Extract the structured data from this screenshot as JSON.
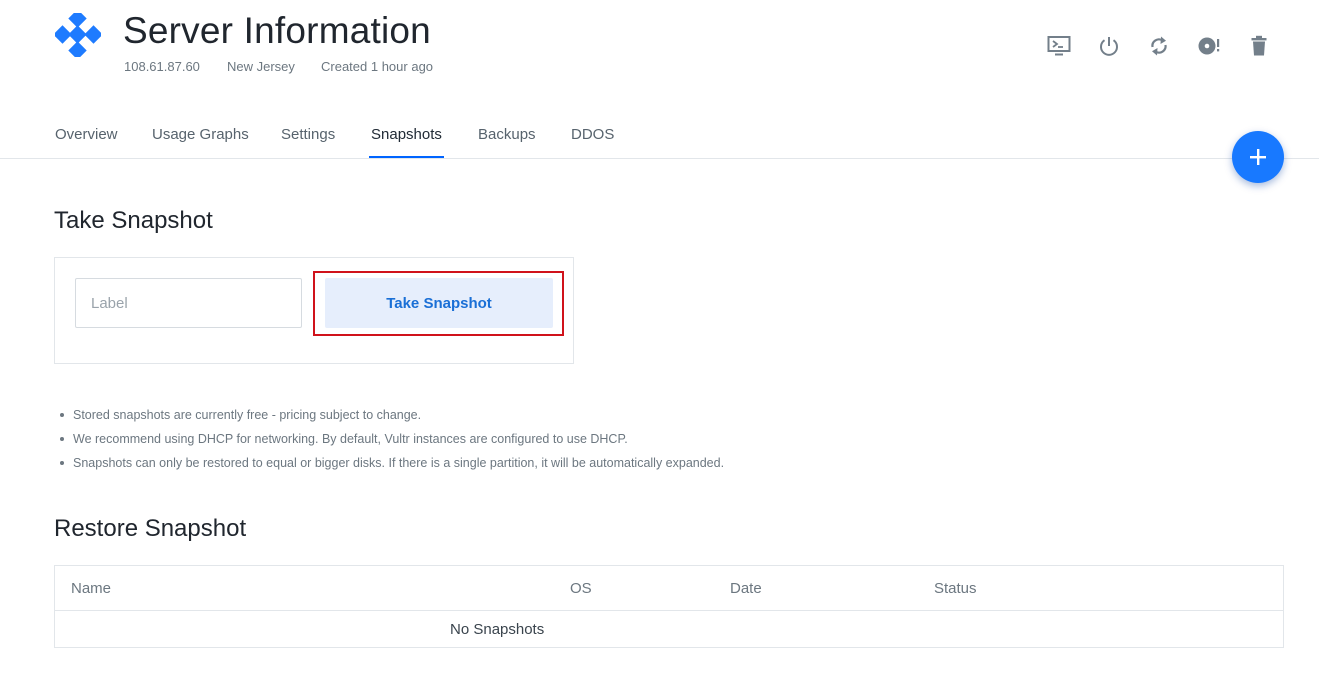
{
  "header": {
    "title": "Server Information",
    "ip": "108.61.87.60",
    "location": "New Jersey",
    "created": "Created 1 hour ago",
    "actions": [
      {
        "name": "console-icon"
      },
      {
        "name": "power-icon"
      },
      {
        "name": "restart-icon"
      },
      {
        "name": "iso-disc-icon"
      },
      {
        "name": "trash-icon"
      }
    ]
  },
  "tabs": [
    {
      "label": "Overview",
      "active": false
    },
    {
      "label": "Usage Graphs",
      "active": false
    },
    {
      "label": "Settings",
      "active": false
    },
    {
      "label": "Snapshots",
      "active": true
    },
    {
      "label": "Backups",
      "active": false
    },
    {
      "label": "DDOS",
      "active": false
    }
  ],
  "fab": {
    "icon": "plus-icon"
  },
  "take_snapshot": {
    "title": "Take Snapshot",
    "label_placeholder": "Label",
    "label_value": "",
    "button_label": "Take Snapshot",
    "notes": [
      "Stored snapshots are currently free - pricing subject to change.",
      "We recommend using DHCP for networking. By default, Vultr instances are configured to use DHCP.",
      "Snapshots can only be restored to equal or bigger disks. If there is a single partition, it will be automatically expanded."
    ]
  },
  "restore_snapshot": {
    "title": "Restore Snapshot",
    "columns": [
      "Name",
      "OS",
      "Date",
      "Status"
    ],
    "empty_text": "No Snapshots"
  },
  "colors": {
    "accent": "#0064ff",
    "fab": "#1879ff",
    "logo": "#1e7bff",
    "button_bg": "#e6eefc",
    "button_text": "#1a6fd6",
    "highlight": "#d0121b"
  }
}
